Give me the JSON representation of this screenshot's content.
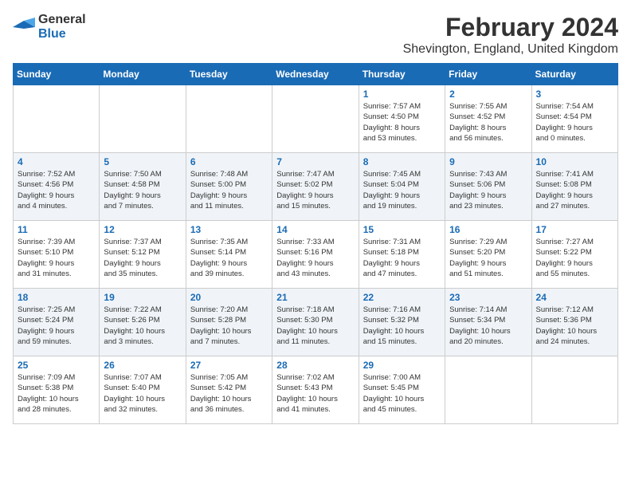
{
  "header": {
    "logo_line1": "General",
    "logo_line2": "Blue",
    "month_year": "February 2024",
    "location": "Shevington, England, United Kingdom"
  },
  "days_of_week": [
    "Sunday",
    "Monday",
    "Tuesday",
    "Wednesday",
    "Thursday",
    "Friday",
    "Saturday"
  ],
  "weeks": [
    [
      {
        "day": "",
        "info": ""
      },
      {
        "day": "",
        "info": ""
      },
      {
        "day": "",
        "info": ""
      },
      {
        "day": "",
        "info": ""
      },
      {
        "day": "1",
        "info": "Sunrise: 7:57 AM\nSunset: 4:50 PM\nDaylight: 8 hours\nand 53 minutes."
      },
      {
        "day": "2",
        "info": "Sunrise: 7:55 AM\nSunset: 4:52 PM\nDaylight: 8 hours\nand 56 minutes."
      },
      {
        "day": "3",
        "info": "Sunrise: 7:54 AM\nSunset: 4:54 PM\nDaylight: 9 hours\nand 0 minutes."
      }
    ],
    [
      {
        "day": "4",
        "info": "Sunrise: 7:52 AM\nSunset: 4:56 PM\nDaylight: 9 hours\nand 4 minutes."
      },
      {
        "day": "5",
        "info": "Sunrise: 7:50 AM\nSunset: 4:58 PM\nDaylight: 9 hours\nand 7 minutes."
      },
      {
        "day": "6",
        "info": "Sunrise: 7:48 AM\nSunset: 5:00 PM\nDaylight: 9 hours\nand 11 minutes."
      },
      {
        "day": "7",
        "info": "Sunrise: 7:47 AM\nSunset: 5:02 PM\nDaylight: 9 hours\nand 15 minutes."
      },
      {
        "day": "8",
        "info": "Sunrise: 7:45 AM\nSunset: 5:04 PM\nDaylight: 9 hours\nand 19 minutes."
      },
      {
        "day": "9",
        "info": "Sunrise: 7:43 AM\nSunset: 5:06 PM\nDaylight: 9 hours\nand 23 minutes."
      },
      {
        "day": "10",
        "info": "Sunrise: 7:41 AM\nSunset: 5:08 PM\nDaylight: 9 hours\nand 27 minutes."
      }
    ],
    [
      {
        "day": "11",
        "info": "Sunrise: 7:39 AM\nSunset: 5:10 PM\nDaylight: 9 hours\nand 31 minutes."
      },
      {
        "day": "12",
        "info": "Sunrise: 7:37 AM\nSunset: 5:12 PM\nDaylight: 9 hours\nand 35 minutes."
      },
      {
        "day": "13",
        "info": "Sunrise: 7:35 AM\nSunset: 5:14 PM\nDaylight: 9 hours\nand 39 minutes."
      },
      {
        "day": "14",
        "info": "Sunrise: 7:33 AM\nSunset: 5:16 PM\nDaylight: 9 hours\nand 43 minutes."
      },
      {
        "day": "15",
        "info": "Sunrise: 7:31 AM\nSunset: 5:18 PM\nDaylight: 9 hours\nand 47 minutes."
      },
      {
        "day": "16",
        "info": "Sunrise: 7:29 AM\nSunset: 5:20 PM\nDaylight: 9 hours\nand 51 minutes."
      },
      {
        "day": "17",
        "info": "Sunrise: 7:27 AM\nSunset: 5:22 PM\nDaylight: 9 hours\nand 55 minutes."
      }
    ],
    [
      {
        "day": "18",
        "info": "Sunrise: 7:25 AM\nSunset: 5:24 PM\nDaylight: 9 hours\nand 59 minutes."
      },
      {
        "day": "19",
        "info": "Sunrise: 7:22 AM\nSunset: 5:26 PM\nDaylight: 10 hours\nand 3 minutes."
      },
      {
        "day": "20",
        "info": "Sunrise: 7:20 AM\nSunset: 5:28 PM\nDaylight: 10 hours\nand 7 minutes."
      },
      {
        "day": "21",
        "info": "Sunrise: 7:18 AM\nSunset: 5:30 PM\nDaylight: 10 hours\nand 11 minutes."
      },
      {
        "day": "22",
        "info": "Sunrise: 7:16 AM\nSunset: 5:32 PM\nDaylight: 10 hours\nand 15 minutes."
      },
      {
        "day": "23",
        "info": "Sunrise: 7:14 AM\nSunset: 5:34 PM\nDaylight: 10 hours\nand 20 minutes."
      },
      {
        "day": "24",
        "info": "Sunrise: 7:12 AM\nSunset: 5:36 PM\nDaylight: 10 hours\nand 24 minutes."
      }
    ],
    [
      {
        "day": "25",
        "info": "Sunrise: 7:09 AM\nSunset: 5:38 PM\nDaylight: 10 hours\nand 28 minutes."
      },
      {
        "day": "26",
        "info": "Sunrise: 7:07 AM\nSunset: 5:40 PM\nDaylight: 10 hours\nand 32 minutes."
      },
      {
        "day": "27",
        "info": "Sunrise: 7:05 AM\nSunset: 5:42 PM\nDaylight: 10 hours\nand 36 minutes."
      },
      {
        "day": "28",
        "info": "Sunrise: 7:02 AM\nSunset: 5:43 PM\nDaylight: 10 hours\nand 41 minutes."
      },
      {
        "day": "29",
        "info": "Sunrise: 7:00 AM\nSunset: 5:45 PM\nDaylight: 10 hours\nand 45 minutes."
      },
      {
        "day": "",
        "info": ""
      },
      {
        "day": "",
        "info": ""
      }
    ]
  ]
}
